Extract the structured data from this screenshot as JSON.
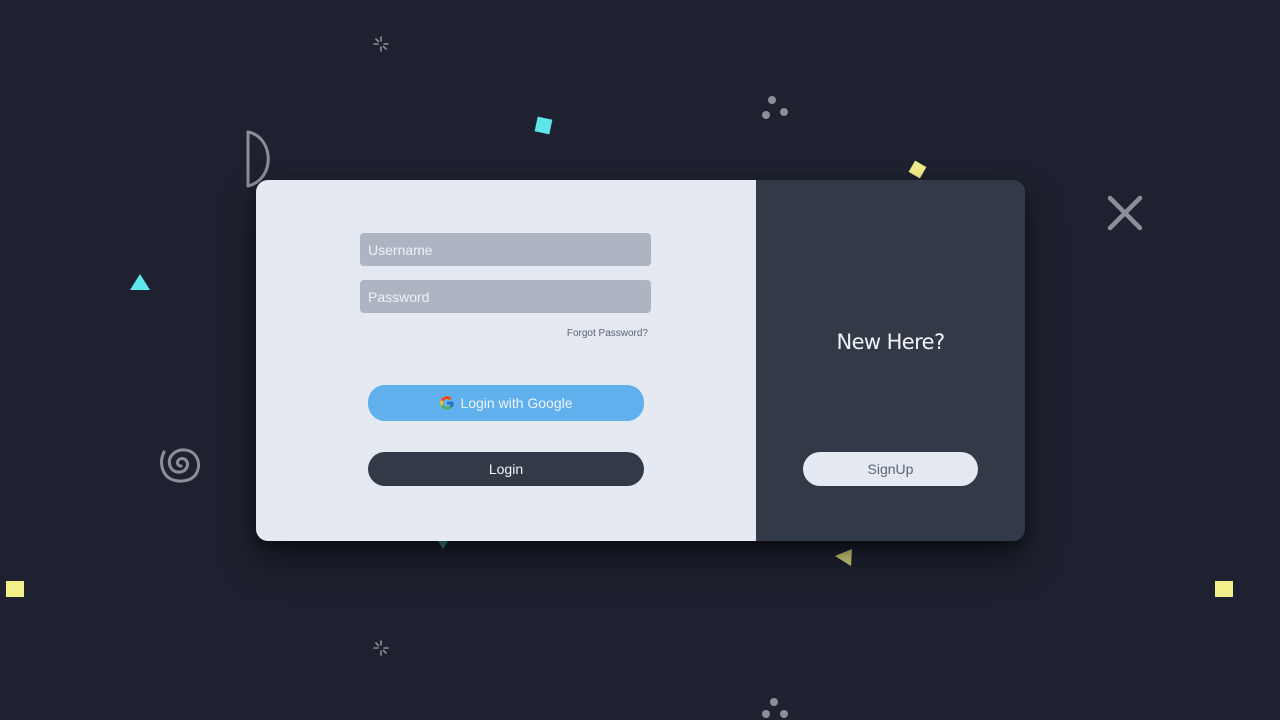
{
  "login_form": {
    "username_placeholder": "Username",
    "password_placeholder": "Password",
    "forgot_password_label": "Forgot Password?",
    "google_button_label": "Login with Google",
    "login_button_label": "Login"
  },
  "signup_panel": {
    "heading": "New Here?",
    "signup_button_label": "SignUp"
  },
  "icons": {
    "google": "google-g-icon"
  },
  "colors": {
    "background": "#1e2230",
    "form_panel": "#e5e9f1",
    "side_panel": "#323a47",
    "input_fill": "#aeb5c2",
    "google_button": "#61b0ee",
    "login_button": "#323a47",
    "deco_cyan": "#5ee6ec",
    "deco_yellow": "#f3ef8a",
    "deco_gray": "#8a8f99"
  }
}
